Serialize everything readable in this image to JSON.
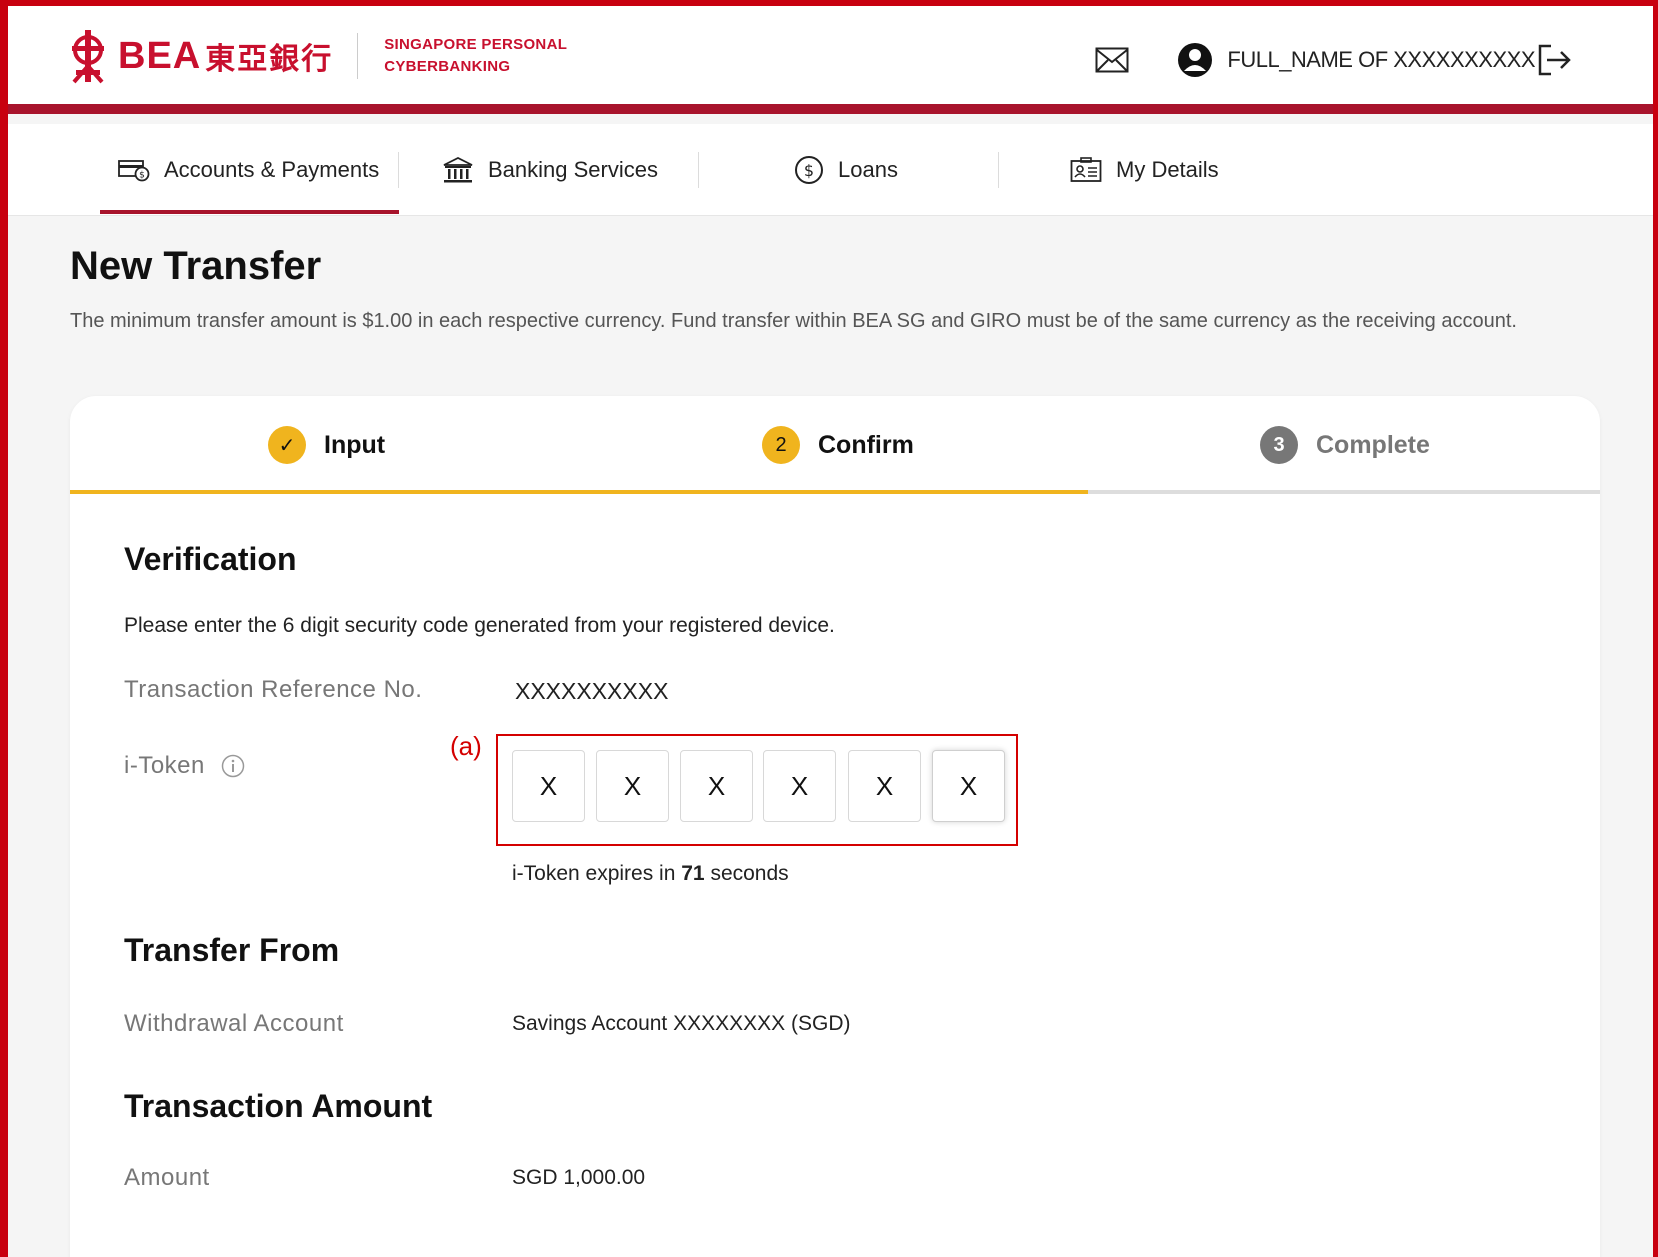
{
  "brand": {
    "name_en": "BEA",
    "name_cn": "東亞銀行",
    "subtitle_line1": "SINGAPORE PERSONAL",
    "subtitle_line2": "CYBERBANKING",
    "color": "#c8102e"
  },
  "header": {
    "user_name": "FULL_NAME OF XXXXXXXXXX",
    "icons": [
      "mail-icon",
      "user-icon",
      "logout-icon"
    ]
  },
  "nav": {
    "items": [
      {
        "label": "Accounts & Payments",
        "icon": "accounts-payments-icon",
        "active": true
      },
      {
        "label": "Banking Services",
        "icon": "bank-building-icon",
        "active": false
      },
      {
        "label": "Loans",
        "icon": "dollar-coin-icon",
        "active": false
      },
      {
        "label": "My Details",
        "icon": "id-card-icon",
        "active": false
      }
    ]
  },
  "page": {
    "title": "New Transfer",
    "description": "The minimum transfer amount is $1.00 in each respective currency. Fund transfer within BEA SG and GIRO must be of the same currency as the receiving account."
  },
  "steps": [
    {
      "label": "Input",
      "marker": "✓",
      "state": "done"
    },
    {
      "label": "Confirm",
      "marker": "2",
      "state": "current"
    },
    {
      "label": "Complete",
      "marker": "3",
      "state": "pending"
    }
  ],
  "verification": {
    "title": "Verification",
    "instruction": "Please enter the 6 digit security code generated from your registered device.",
    "ref_label": "Transaction Reference No.",
    "ref_value": "XXXXXXXXXX",
    "token_label": "i-Token",
    "token_info_icon": "info-icon",
    "annotation": "(a)",
    "token_digits": [
      "X",
      "X",
      "X",
      "X",
      "X",
      "X"
    ],
    "expiry_prefix": "i-Token expires in ",
    "expiry_seconds": "71",
    "expiry_suffix": " seconds"
  },
  "transfer_from": {
    "title": "Transfer From",
    "label": "Withdrawal Account",
    "value": "Savings Account XXXXXXXX (SGD)"
  },
  "transaction_amount": {
    "title": "Transaction Amount",
    "label": "Amount",
    "value": "SGD 1,000.00"
  },
  "colors": {
    "header_bar": "#a8142c",
    "step_active": "#f0b41e",
    "step_pending": "#777777",
    "annotation": "#d40000"
  }
}
